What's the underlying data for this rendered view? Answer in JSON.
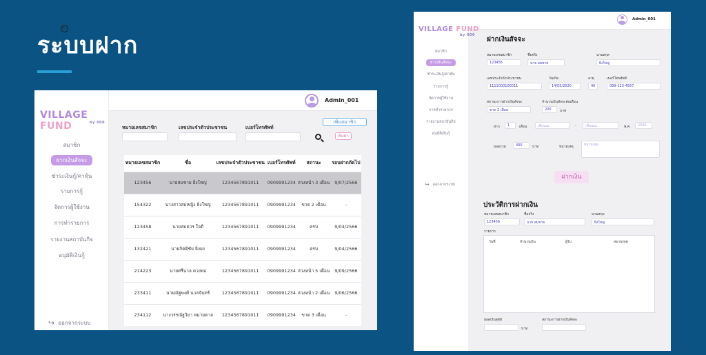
{
  "slide": {
    "title": "ระบบฝาก"
  },
  "app": {
    "logo_main": "VILLAGE ",
    "logo_accent": "FUND",
    "logo_small": "by 000",
    "admin_name": "Admin_001",
    "logout_label": "ออกจากระบบ"
  },
  "screen1": {
    "nav": [
      "สมาชิก",
      "ฝากเงินสัจจะ",
      "ชำระเงินกู้/ค่าหุ้น",
      "รายการกู้",
      "จัดการผู้ใช้งาน",
      "การทำรายการ",
      "รายงานสถาบันกิจ",
      "อนุมัติเงินกู้"
    ],
    "filters": {
      "member_no": "หมายเลขสมาชิก",
      "citizen_id": "เลขประจำตัวประชาชน",
      "phone": "เบอร์โทรศัพท์"
    },
    "add_member_label": "เพิ่มสมาชิก",
    "search_label": "ค้นหา",
    "table": {
      "headers": [
        "หมายเลขสมาชิก",
        "ชื่อ",
        "เลขประจำตัวประชาชน",
        "เบอร์โทรศัพท์",
        "สถานะ",
        "รอบฝากถัดไป"
      ],
      "rows": [
        [
          "123456",
          "นายสมชาย ยิ่งใหญ่",
          "1234567891011",
          "0909991234",
          "ล่วงหน้า 3 เดือน",
          "9/07/2566"
        ],
        [
          "154322",
          "นางสาวสมหญิง ยิ่งใหญ่",
          "1234567891011",
          "0909991234",
          "ขาด 2 เดือน",
          "-"
        ],
        [
          "123458",
          "นายสมควร ใจดี",
          "1234567891011",
          "0909991234",
          "ครบ",
          "9/04/2566"
        ],
        [
          "132421",
          "นายกิตติชัย ยิ่งยง",
          "1234567891011",
          "0909991234",
          "ครบ",
          "9/04/2566"
        ],
        [
          "214223",
          "นายศรีนวล ดวงพ่อ",
          "1234567891011",
          "0909991234",
          "ล่วงหน้า 5 เดือน",
          "9/09/2566"
        ],
        [
          "233411",
          "นายณัฐพงศ์ นวลจันทร์",
          "1234567891011",
          "0909991234",
          "ล่วงหน้า 2 เดือน",
          "9/06/2566"
        ],
        [
          "234112",
          "นางวรรณัฐวิยา หมายตาล",
          "1234567891011",
          "0909991234",
          "ขาด 3 เดือน",
          "-"
        ]
      ]
    }
  },
  "screen2": {
    "nav": [
      "สมาชิก",
      "ฝากเงินสัจจะ",
      "ชำระเงินกู้/ค่าหุ้น",
      "รายการกู้",
      "จัดการผู้ใช้งาน",
      "การทำรายการ",
      "รายงานสถาบันกิจ",
      "อนุมัติเงินกู้"
    ],
    "page_title": "ฝากเงินสัจจะ",
    "fields": {
      "member_no_label": "หมายเลขสมาชิก",
      "member_no": "123456",
      "fname_label": "ชื่อจริง",
      "fname": "นาย สมชาย",
      "lname_label": "นามสกุล",
      "lname": "ยิ่งใหญ่",
      "citizen_label": "เลขประจำตัวประชาชน",
      "citizen": "1111000100011",
      "birth_label": "วันเกิด",
      "birth": "14/05/2520",
      "age_label": "อายุ",
      "age": "46",
      "phone_label": "เบอร์โทรศัพท์",
      "phone": "089-123-4567",
      "status_label": "สถานะการฝากเงินสัจจะ",
      "status": "ขาด 2 เดือน",
      "amount_label": "จำนวนเงินสัจจะต่อเดือน",
      "amount": "200",
      "baht": "บาท",
      "from_label": "ฝาก",
      "from_count": "1",
      "month_label": "เดือน",
      "month_from": "เดือนเม.",
      "month_to": "เดือนเม.",
      "year_label": "พ.ศ.",
      "year": "2566",
      "total_label": "ยอดรวม",
      "total": "400",
      "note_label": "หมายเหตุ",
      "note": "หมายเหตุ"
    },
    "deposit_button": "ฝากเงิน",
    "history": {
      "title": "ประวัติการฝากเงิน",
      "member_no_label": "หมายเลขสมาชิก",
      "member_no": "123456",
      "fname_label": "ชื่อจริง",
      "fname": "นาย สมชาย",
      "lname_label": "นามสกุล",
      "lname": "ยิ่งใหญ่",
      "list_label": "รายการ",
      "cols": [
        "วันที่",
        "จำนวนเงิน",
        "ผู้รับ",
        "หมายเหตุ"
      ],
      "balance_label": "ยอดเงินสุทธิ",
      "baht": "บาท",
      "status_label": "สถานะการฝากเงินสัจจะ"
    }
  }
}
